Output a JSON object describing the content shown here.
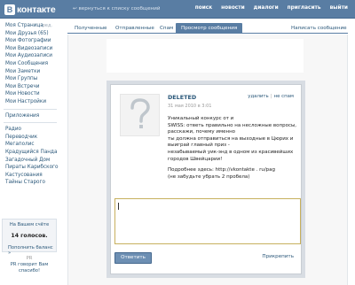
{
  "header": {
    "logo_letter": "B",
    "logo_text": "контакте",
    "back_link": "↩ вернуться к списку сообщений",
    "nav": [
      "поиск",
      "новости",
      "диалоги",
      "пригласить",
      "выйти"
    ]
  },
  "sidebar": {
    "items": [
      {
        "label": "Моя Страница",
        "extra": "ред."
      },
      {
        "label": "Мои Друзья (65)"
      },
      {
        "label": "Мои Фотографии"
      },
      {
        "label": "Мои Видеозаписи"
      },
      {
        "label": "Мои Аудиозаписи"
      },
      {
        "label": "Мои Сообщения"
      },
      {
        "label": "Мои Заметки"
      },
      {
        "label": "Мои Группы"
      },
      {
        "label": "Мои Встречи"
      },
      {
        "label": "Мои Новости"
      },
      {
        "label": "Мои Настройки"
      }
    ],
    "apps_label": "Приложения",
    "apps": [
      "Радио",
      "Переводчик",
      "Мегаполис",
      "Крадущийся Панда",
      "Загадочный Дом",
      "Пираты Карибского",
      "Кастусования",
      "Тайны Старого"
    ],
    "balance": {
      "title": "На Вашем счёте",
      "amount": "14 голосов.",
      "link": "Пополнить баланс »"
    },
    "ad": {
      "label": "PR",
      "text": "PR говорит Вам спасибо!"
    }
  },
  "tabs": [
    {
      "label": "Полученные",
      "active": false
    },
    {
      "label": "Отправленные",
      "active": false
    },
    {
      "label": "Спам",
      "active": false
    },
    {
      "label": "Просмотр сообщения",
      "active": true
    },
    {
      "label": "Написать сообщение",
      "active": false
    }
  ],
  "message": {
    "sender": "DELETED",
    "date": "31 мая 2010 в 3:01",
    "actions": {
      "delete": "удалить",
      "not_spam": "не спам"
    },
    "body_lines": [
      "Уникальный конкурс от                и",
      "SWISS: ответь правильно на несложные вопросы,",
      "расскажи, почему именно",
      "ты должна отправиться на выходные в Цюрих и",
      "выиграй главный приз -",
      "незабываемый уик-энд в одном из красивейших",
      "городов Швейцарии!",
      "",
      "Подробнее здесь: http://vkontakte . ru/pag",
      "(не забудьте убрать 2 пробела)"
    ]
  },
  "reply": {
    "placeholder": "",
    "send_label": "Ответить",
    "attach_label": "Прикрепить"
  }
}
